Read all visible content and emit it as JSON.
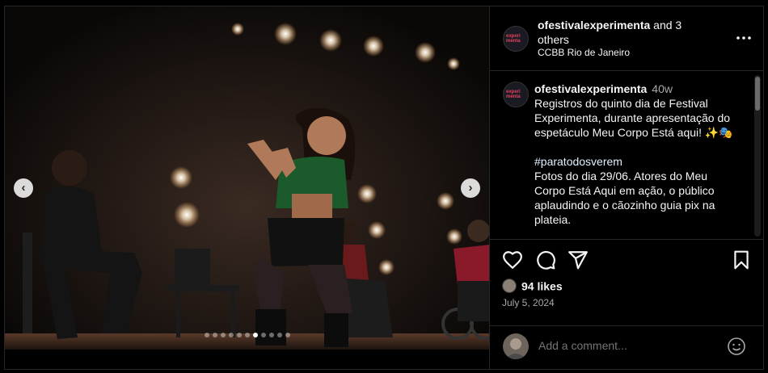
{
  "post": {
    "author": "ofestivalexperimenta",
    "coauthors": " and 3 others",
    "location": "CCBB Rio de Janeiro",
    "avatar_logo": [
      "experi",
      "menta"
    ],
    "caption": {
      "author": "ofestivalexperimenta",
      "time": "40w",
      "text": "Registros do quinto dia de Festival Experimenta, durante apresentação do espetáculo Meu Corpo Está aqui! ✨🎭",
      "hashtag": "#paratodosverem",
      "text2": "Fotos do dia 29/06. Atores do Meu Corpo Está Aqui em ação, o público aplaudindo e o cãozinho guia pix na plateia."
    },
    "likes": "94 likes",
    "date": "July 5, 2024"
  },
  "carousel": {
    "prev_label": "‹",
    "next_label": "›",
    "total": 11,
    "active_index": 6
  },
  "icons": [
    "heart-icon",
    "comment-icon",
    "share-icon",
    "bookmark-icon",
    "more-icon",
    "emoji-icon"
  ],
  "comment": {
    "placeholder": "Add a comment..."
  }
}
